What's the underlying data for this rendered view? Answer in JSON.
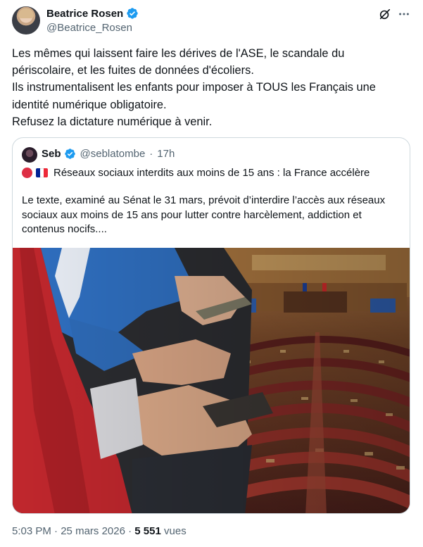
{
  "author": {
    "display_name": "Beatrice Rosen",
    "handle": "@Beatrice_Rosen",
    "avatar_icon": "user-avatar",
    "verified": true
  },
  "actions": {
    "grok_icon": "grok-icon",
    "more_icon": "more-horizontal-icon"
  },
  "tweet": {
    "lines": [
      "Les mêmes qui laissent faire les dérives de l'ASE, le scandale du",
      "périscolaire, et les fuites de données d'écoliers.",
      "Ils instrumentalisent les enfants pour imposer à TOUS les Français une",
      "identité numérique obligatoire.",
      "Refusez la dictature numérique à venir."
    ]
  },
  "quote": {
    "display_name": "Seb",
    "handle": "@seblatombe",
    "separator": "·",
    "time": "17h",
    "verified": true,
    "title": "Réseaux sociaux interdits aux moins de 15 ans : la France accélère",
    "title_icons": [
      "red-circle-icon",
      "france-flag-icon"
    ],
    "body_lines": [
      "Le texte, examiné au Sénat le 31 mars, prévoit d’interdire l’accès aux réseaux",
      "sociaux aux moins de 15 ans pour lutter contre harcèlement, addiction et",
      "contenus nocifs...."
    ],
    "media_description_icon": "photo-composite-icon"
  },
  "footer": {
    "time": "5:03 PM",
    "separator": "·",
    "date": "25 mars 2026",
    "views_count": "5 551",
    "views_label": "vues"
  },
  "colors": {
    "text_primary": "#0f1419",
    "text_secondary": "#536471",
    "verified_blue": "#1d9bf0",
    "border": "#cfd9de"
  }
}
